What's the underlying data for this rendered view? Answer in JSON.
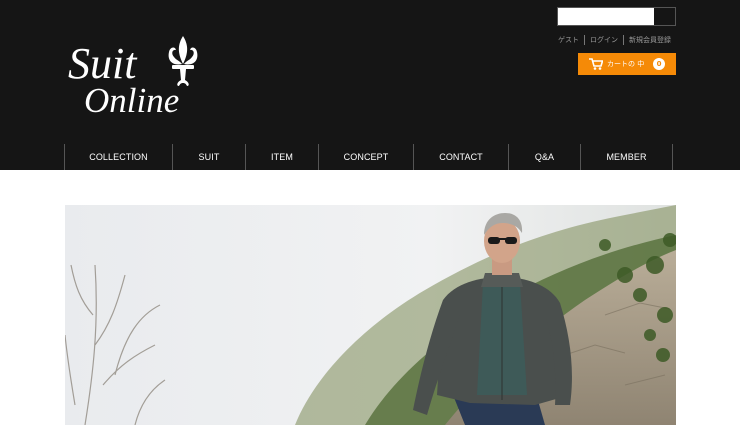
{
  "logo": {
    "line1": "Suit",
    "line2": "Online"
  },
  "search": {
    "placeholder": ""
  },
  "util_links": [
    {
      "label": "ゲスト"
    },
    {
      "label": "ログイン"
    },
    {
      "label": "新規会員登録"
    }
  ],
  "cart": {
    "label": "カートの 中",
    "count": "0",
    "color": "#f58a07"
  },
  "nav": [
    {
      "label": "COLLECTION"
    },
    {
      "label": "SUIT"
    },
    {
      "label": "ITEM"
    },
    {
      "label": "CONCEPT"
    },
    {
      "label": "CONTACT"
    },
    {
      "label": "Q&A"
    },
    {
      "label": "MEMBER"
    }
  ],
  "colors": {
    "header_bg": "#151515",
    "accent": "#f58a07"
  },
  "hero": {
    "content": "man-in-knit-jacket-and-sunglasses-on-rocky-path-photo"
  }
}
